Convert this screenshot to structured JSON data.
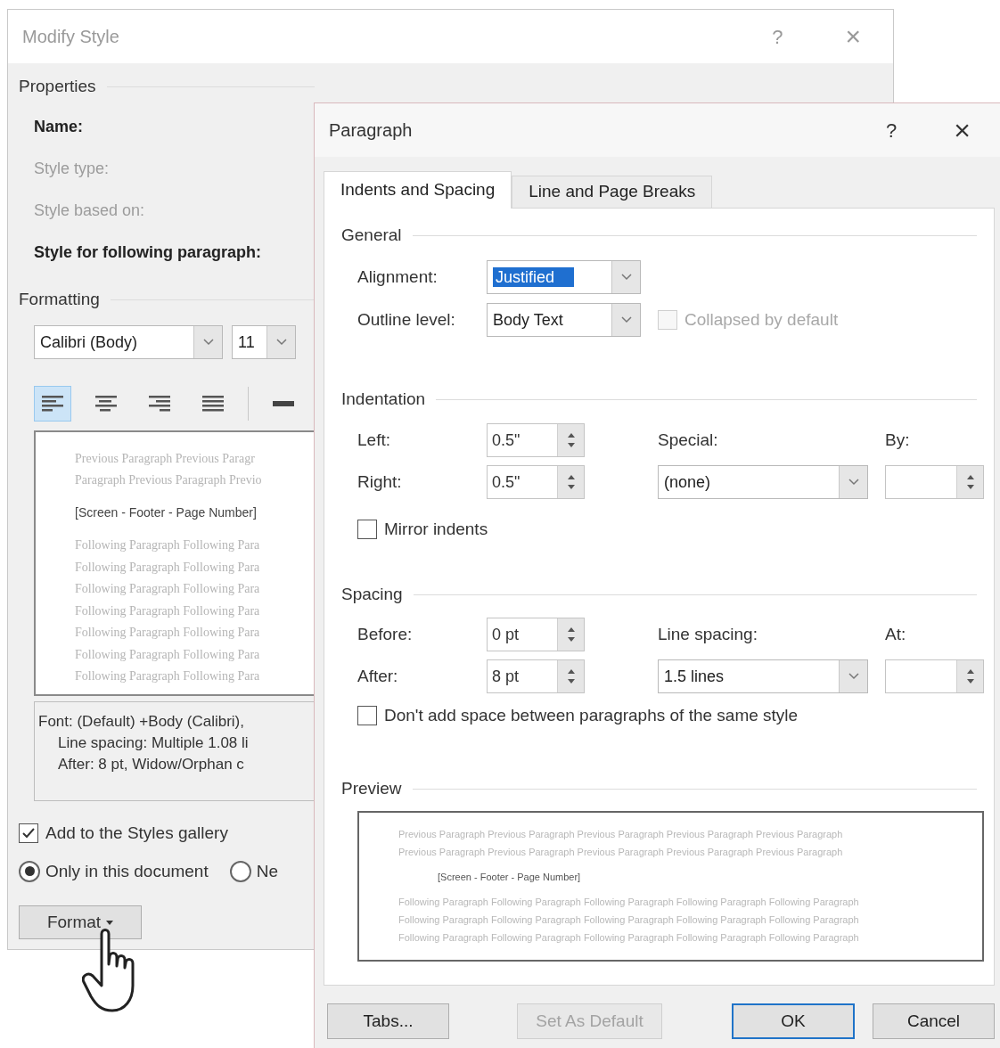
{
  "modify_style": {
    "title": "Modify Style",
    "help": "?",
    "close": "×",
    "properties": {
      "heading": "Properties",
      "fields": [
        {
          "label": "Name:",
          "disabled": false
        },
        {
          "label": "Style type:",
          "disabled": true
        },
        {
          "label": "Style based on:",
          "disabled": true
        },
        {
          "label": "Style for following paragraph:",
          "disabled": false
        }
      ]
    },
    "formatting": {
      "heading": "Formatting",
      "font": "Calibri (Body)",
      "size": "11",
      "toolbar": [
        {
          "kind": "left",
          "selected": true
        },
        {
          "kind": "center",
          "selected": false
        },
        {
          "kind": "right",
          "selected": false
        },
        {
          "kind": "justify",
          "selected": false
        },
        {
          "kind": "single",
          "selected": false
        }
      ]
    },
    "preview": {
      "previous_lines": [
        "Previous Paragraph Previous Paragr",
        "Paragraph Previous Paragraph Previo"
      ],
      "sample": "[Screen - Footer - Page Number]",
      "following_lines": [
        "Following Paragraph Following Para",
        "Following Paragraph Following Para",
        "Following Paragraph Following Para",
        "Following Paragraph Following Para",
        "Following Paragraph Following Para",
        "Following Paragraph Following Para",
        "Following Paragraph Following Para"
      ]
    },
    "description": [
      "Font: (Default) +Body (Calibri),",
      "Line spacing:  Multiple 1.08 li",
      "After:  8 pt, Widow/Orphan c"
    ],
    "add_to_gallery": {
      "label": "Add to the Styles gallery",
      "checked": true
    },
    "scope": [
      {
        "label": "Only in this document",
        "selected": true
      },
      {
        "label": "Ne",
        "selected": false
      }
    ],
    "format_button": "Format"
  },
  "paragraph": {
    "title": "Paragraph",
    "help": "?",
    "close": "×",
    "tabs": [
      {
        "label": "Indents and Spacing",
        "selected": true
      },
      {
        "label": "Line and Page Breaks",
        "selected": false
      }
    ],
    "general": {
      "heading": "General",
      "alignment": {
        "label": "Alignment:",
        "value": "Justified"
      },
      "outline": {
        "label": "Outline level:",
        "value": "Body Text"
      },
      "collapsed": {
        "label": "Collapsed by default",
        "checked": false,
        "disabled": true
      }
    },
    "indentation": {
      "heading": "Indentation",
      "left": {
        "label": "Left:",
        "value": "0.5\""
      },
      "right": {
        "label": "Right:",
        "value": "0.5\""
      },
      "special": {
        "label": "Special:",
        "value": "(none)"
      },
      "by": {
        "label": "By:"
      },
      "mirror": {
        "label": "Mirror indents",
        "checked": false
      }
    },
    "spacing": {
      "heading": "Spacing",
      "before": {
        "label": "Before:",
        "value": "0 pt"
      },
      "after": {
        "label": "After:",
        "value": "8 pt"
      },
      "line_spacing": {
        "label": "Line spacing:",
        "value": "1.5 lines"
      },
      "at": {
        "label": "At:"
      },
      "dont_add": {
        "label": "Don't add space between paragraphs of the same style",
        "checked": false
      }
    },
    "preview": {
      "heading": "Preview",
      "previous_lines": [
        "Previous Paragraph Previous Paragraph Previous Paragraph Previous Paragraph Previous Paragraph",
        "Previous Paragraph Previous Paragraph Previous Paragraph Previous Paragraph Previous Paragraph"
      ],
      "sample": "[Screen - Footer - Page Number]",
      "following_lines": [
        "Following Paragraph Following Paragraph Following Paragraph Following Paragraph Following Paragraph",
        "Following Paragraph Following Paragraph Following Paragraph Following Paragraph Following Paragraph",
        "Following Paragraph Following Paragraph Following Paragraph Following Paragraph Following Paragraph"
      ]
    },
    "buttons": [
      {
        "label": "Tabs...",
        "disabled": false,
        "default": false
      },
      {
        "label": "Set As Default",
        "disabled": true,
        "default": false
      },
      {
        "label": "OK",
        "disabled": false,
        "default": true
      },
      {
        "label": "Cancel",
        "disabled": false,
        "default": false
      }
    ]
  }
}
